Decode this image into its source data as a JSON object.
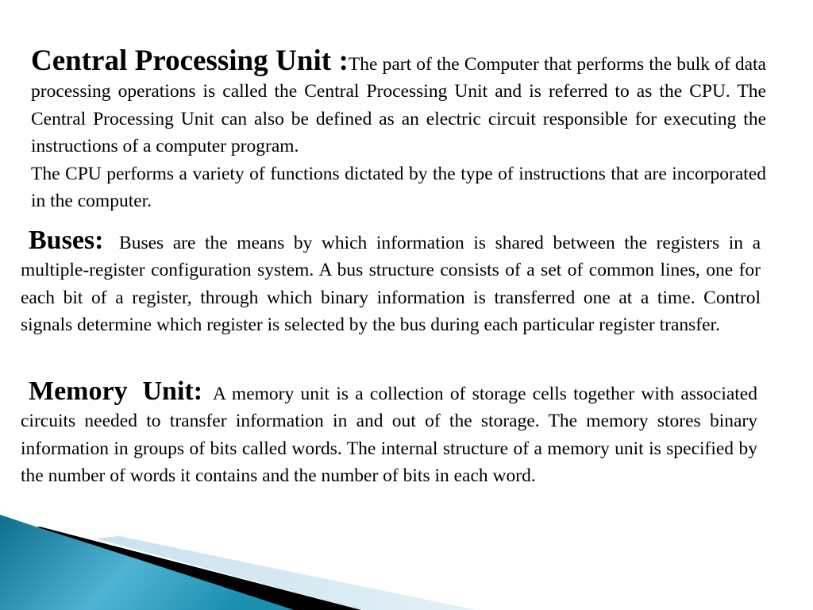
{
  "slide": {
    "sections": [
      {
        "heading": "Central Processing Unit :",
        "text_part1": "The part of the Computer that performs the bulk of data processing operations is called the Central Processing Unit and is referred to as the CPU. The Central Processing Unit can also be defined as an electric circuit responsible for executing the instructions of a computer program.",
        "text_part2": "The CPU performs a variety of functions dictated by the type of instructions that are incorporated in the computer."
      },
      {
        "heading": "Buses:",
        "text": "Buses are the means by which information is shared between the registers in a multiple-register configuration system. A bus structure consists of a set of common lines, one for each bit of a register, through which binary information is transferred one at a time. Control signals determine which register is selected by the bus during each particular register transfer."
      },
      {
        "heading": "Memory Unit:",
        "text": "A memory unit is a collection of storage cells together with associated circuits needed to transfer information in and out of the storage. The memory stores binary information in groups of bits called words. The internal structure of a memory unit is specified by the number of words it contains and the number of bits in each word."
      }
    ]
  },
  "theme": {
    "decor_teal_dark": "#0e6f8c",
    "decor_teal_light": "#4fb3d3",
    "decor_black": "#000000",
    "decor_pale_blue": "#d6e8f1"
  }
}
